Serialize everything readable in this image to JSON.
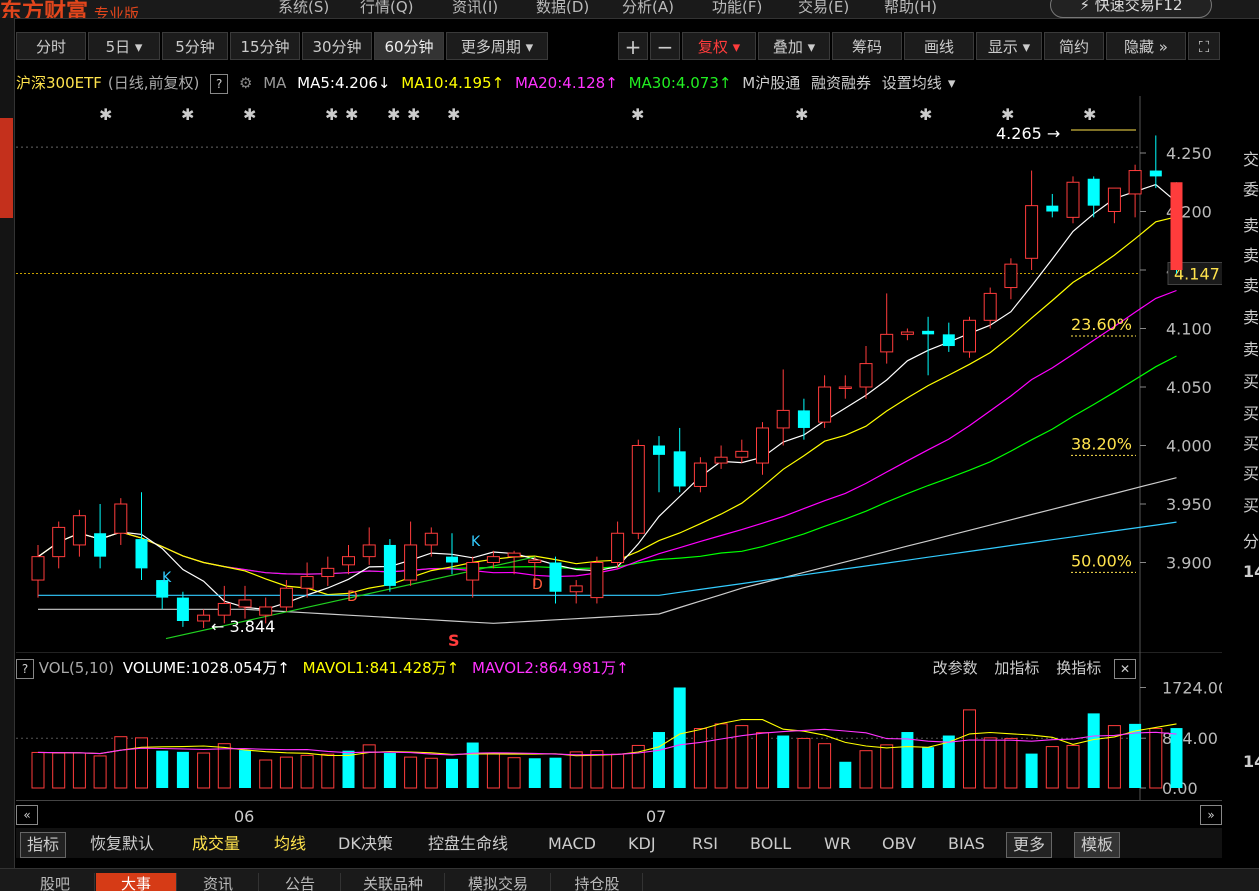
{
  "app": {
    "brand": "东方财富",
    "edition": "专业版",
    "quick_trade": "快速交易F12"
  },
  "menu": [
    "系统(S)",
    "行情(Q)",
    "资讯(I)",
    "数据(D)",
    "分析(A)",
    "功能(F)",
    "交易(E)",
    "帮助(H)"
  ],
  "toolbar": {
    "periods": [
      "分时",
      "5日",
      "5分钟",
      "15分钟",
      "30分钟",
      "60分钟",
      "更多周期"
    ],
    "actions": [
      "复权",
      "叠加",
      "筹码",
      "画线",
      "显示",
      "简约",
      "隐藏"
    ]
  },
  "info": {
    "name": "沪深300ETF",
    "mode": "(日线,前复权)",
    "ma_label": "MA",
    "ma5": "MA5:4.206",
    "ma5_arrow": "↓",
    "ma10": "MA10:4.195",
    "ma10_arrow": "↑",
    "ma20": "MA20:4.128",
    "ma20_arrow": "↑",
    "ma30": "MA30:4.073",
    "ma30_arrow": "↑",
    "m_label": "M",
    "extra1": "沪股通",
    "extra2": "融资融券",
    "extra3": "设置均线"
  },
  "volume_info": {
    "label": "VOL(5,10)",
    "volume": "VOLUME:1028.054万",
    "volume_arrow": "↑",
    "mavol1": "MAVOL1:841.428万",
    "mavol1_arrow": "↑",
    "mavol2": "MAVOL2:864.981万",
    "mavol2_arrow": "↑",
    "actions": [
      "改参数",
      "加指标",
      "换指标"
    ]
  },
  "chart_data": {
    "type": "candlestick",
    "price_axis": {
      "ticks": [
        "4.250",
        "4.200",
        "4.150",
        "4.100",
        "4.050",
        "4.000",
        "3.950",
        "3.900"
      ],
      "current": "4.147"
    },
    "annotations": {
      "high": "4.265",
      "low": "3.844",
      "fib": [
        "23.60%",
        "38.20%",
        "50.00%"
      ],
      "markers": [
        "K",
        "K",
        "D",
        "D",
        "S"
      ]
    },
    "x_labels": [
      "06",
      "07"
    ],
    "candles": [
      [
        3.885,
        3.905,
        3.87,
        3.915
      ],
      [
        3.905,
        3.93,
        3.895,
        3.935
      ],
      [
        3.915,
        3.94,
        3.905,
        3.945
      ],
      [
        3.925,
        3.905,
        3.895,
        3.95
      ],
      [
        3.925,
        3.95,
        3.915,
        3.955
      ],
      [
        3.92,
        3.895,
        3.885,
        3.96
      ],
      [
        3.885,
        3.87,
        3.86,
        3.885
      ],
      [
        3.87,
        3.85,
        3.845,
        3.875
      ],
      [
        3.85,
        3.855,
        3.844,
        3.86
      ],
      [
        3.855,
        3.865,
        3.848,
        3.88
      ],
      [
        3.862,
        3.868,
        3.852,
        3.88
      ],
      [
        3.855,
        3.862,
        3.848,
        3.87
      ],
      [
        3.862,
        3.878,
        3.858,
        3.885
      ],
      [
        3.878,
        3.888,
        3.87,
        3.9
      ],
      [
        3.888,
        3.895,
        3.88,
        3.905
      ],
      [
        3.898,
        3.905,
        3.89,
        3.915
      ],
      [
        3.905,
        3.915,
        3.898,
        3.93
      ],
      [
        3.915,
        3.88,
        3.875,
        3.92
      ],
      [
        3.885,
        3.915,
        3.88,
        3.935
      ],
      [
        3.915,
        3.925,
        3.905,
        3.93
      ],
      [
        3.905,
        3.9,
        3.89,
        3.925
      ],
      [
        3.885,
        3.9,
        3.87,
        3.905
      ],
      [
        3.9,
        3.905,
        3.895,
        3.91
      ],
      [
        3.905,
        3.908,
        3.89,
        3.91
      ],
      [
        3.9,
        3.902,
        3.88,
        3.905
      ],
      [
        3.9,
        3.875,
        3.865,
        3.905
      ],
      [
        3.875,
        3.88,
        3.865,
        3.885
      ],
      [
        3.87,
        3.9,
        3.865,
        3.905
      ],
      [
        3.9,
        3.925,
        3.895,
        3.935
      ],
      [
        3.925,
        4.0,
        3.92,
        4.005
      ],
      [
        4.0,
        3.992,
        3.96,
        4.008
      ],
      [
        3.995,
        3.965,
        3.96,
        4.015
      ],
      [
        3.965,
        3.985,
        3.96,
        3.99
      ],
      [
        3.985,
        3.99,
        3.98,
        4.0
      ],
      [
        3.99,
        3.995,
        3.985,
        4.005
      ],
      [
        3.985,
        4.015,
        3.975,
        4.02
      ],
      [
        4.015,
        4.03,
        4.0,
        4.065
      ],
      [
        4.03,
        4.015,
        4.005,
        4.04
      ],
      [
        4.02,
        4.05,
        4.015,
        4.06
      ],
      [
        4.05,
        4.05,
        4.04,
        4.06
      ],
      [
        4.05,
        4.07,
        4.04,
        4.085
      ],
      [
        4.08,
        4.095,
        4.07,
        4.13
      ],
      [
        4.095,
        4.097,
        4.09,
        4.1
      ],
      [
        4.098,
        4.095,
        4.06,
        4.11
      ],
      [
        4.095,
        4.085,
        4.08,
        4.105
      ],
      [
        4.08,
        4.107,
        4.075,
        4.11
      ],
      [
        4.107,
        4.13,
        4.1,
        4.135
      ],
      [
        4.135,
        4.155,
        4.125,
        4.16
      ],
      [
        4.16,
        4.205,
        4.15,
        4.235
      ],
      [
        4.205,
        4.2,
        4.195,
        4.215
      ],
      [
        4.195,
        4.225,
        4.19,
        4.23
      ],
      [
        4.228,
        4.205,
        4.195,
        4.23
      ],
      [
        4.2,
        4.22,
        4.19,
        4.22
      ],
      [
        4.215,
        4.235,
        4.195,
        4.24
      ],
      [
        4.235,
        4.23,
        4.22,
        4.265
      ],
      [
        4.225,
        4.15,
        4.147,
        4.225
      ]
    ],
    "volume_axis": {
      "ticks": [
        "1724.00",
        "854.00",
        "0.00"
      ]
    },
    "volumes": [
      610,
      600,
      600,
      550,
      880,
      860,
      640,
      620,
      600,
      760,
      650,
      480,
      530,
      560,
      580,
      640,
      740,
      600,
      530,
      510,
      500,
      780,
      600,
      520,
      510,
      520,
      620,
      640,
      580,
      730,
      960,
      1724,
      1020,
      1100,
      1070,
      950,
      900,
      850,
      760,
      450,
      640,
      740,
      960,
      700,
      900,
      1340,
      860,
      850,
      590,
      710,
      730,
      1280,
      1070,
      1100,
      1020,
      1028
    ],
    "volume_rising": [
      true,
      true,
      true,
      true,
      true,
      true,
      false,
      false,
      true,
      true,
      false,
      true,
      true,
      true,
      true,
      false,
      true,
      false,
      true,
      true,
      false,
      false,
      true,
      true,
      false,
      false,
      true,
      true,
      true,
      true,
      false,
      false,
      true,
      true,
      true,
      true,
      false,
      true,
      true,
      false,
      true,
      true,
      false,
      false,
      false,
      true,
      true,
      true,
      false,
      true,
      true,
      false,
      true,
      false,
      true,
      false
    ]
  },
  "indicator_tabs": [
    "指标",
    "恢复默认",
    "成交量",
    "均线",
    "DK决策",
    "控盘生命线",
    "MACD",
    "KDJ",
    "RSI",
    "BOLL",
    "WR",
    "OBV",
    "BIAS",
    "更多",
    "模板"
  ],
  "bottom_tabs": [
    "股吧",
    "大事",
    "资讯",
    "公告",
    "关联品种",
    "模拟交易",
    "持仓股"
  ],
  "right_panel": [
    "交",
    "委",
    "卖",
    "卖",
    "卖",
    "卖",
    "卖",
    "买",
    "买",
    "买",
    "买",
    "买",
    "分",
    "14",
    "14"
  ],
  "colors": {
    "up": "#ff3c3c",
    "down": "#00ffff",
    "ma5": "#ffffff",
    "ma10": "#ffff00",
    "ma20": "#ff00ff",
    "ma30": "#00ff00",
    "ma60": "#ffffff",
    "ma120": "#33ccff"
  }
}
